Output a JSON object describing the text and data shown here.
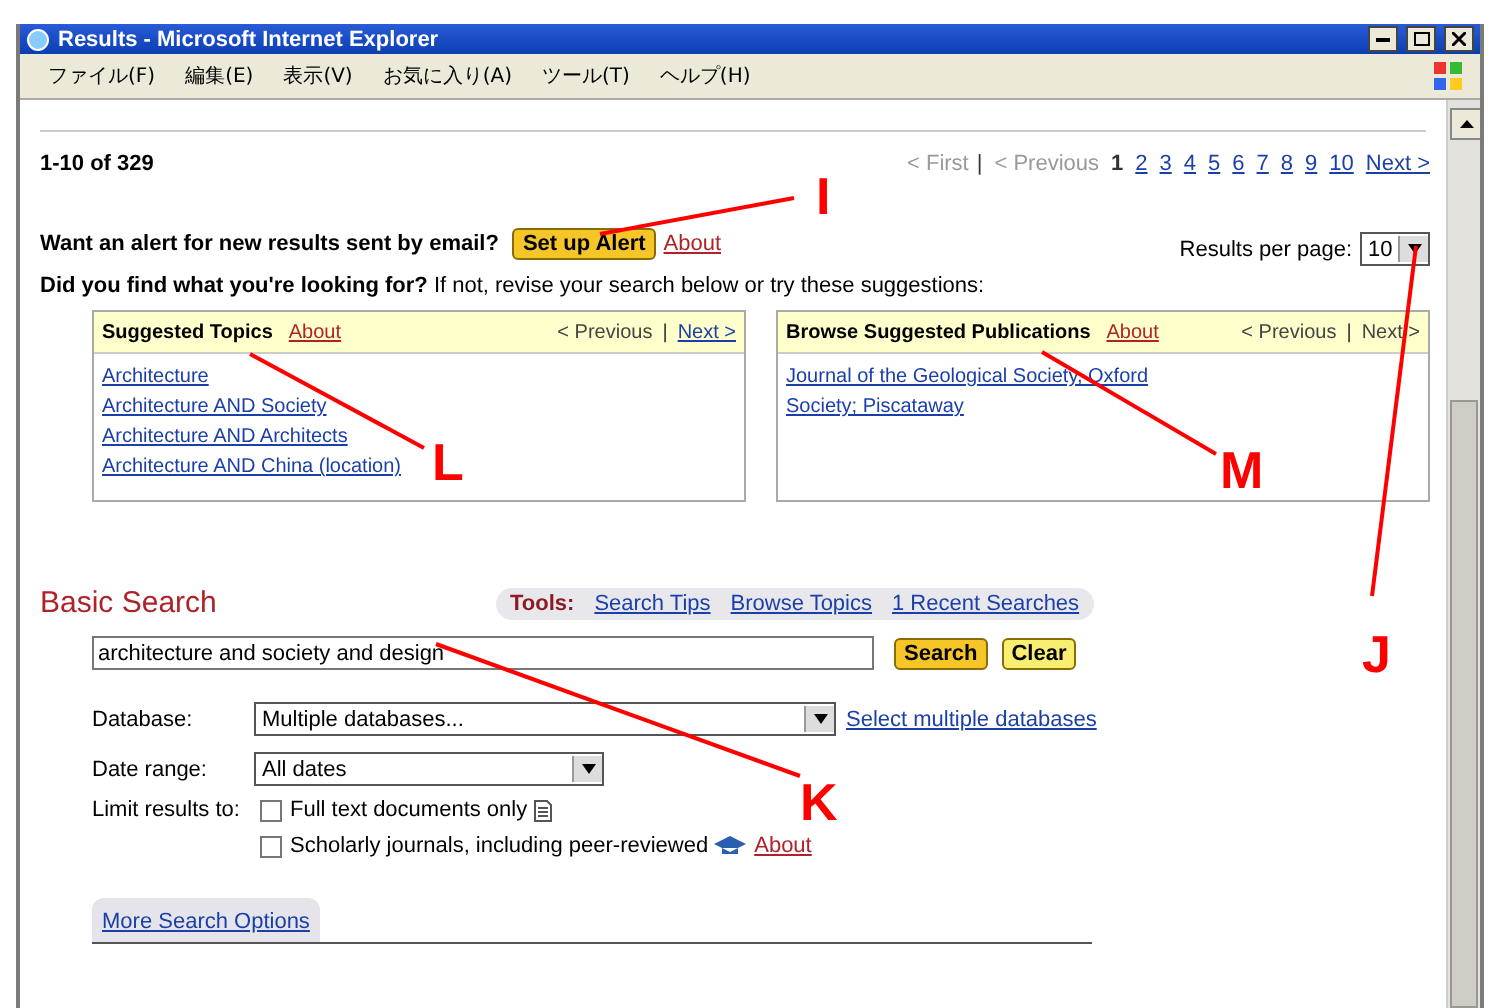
{
  "window": {
    "title": "Results - Microsoft Internet Explorer"
  },
  "menu": [
    "ファイル(F)",
    "編集(E)",
    "表示(V)",
    "お気に入り(A)",
    "ツール(T)",
    "ヘルプ(H)"
  ],
  "results": {
    "range": "1-10 of 329",
    "separator": "|",
    "pager": [
      {
        "label": "< First",
        "kind": "disabled"
      },
      {
        "label": "< Previous",
        "kind": "disabled"
      },
      {
        "label": "1",
        "kind": "current"
      },
      {
        "label": "2",
        "kind": "link"
      },
      {
        "label": "3",
        "kind": "link"
      },
      {
        "label": "4",
        "kind": "link"
      },
      {
        "label": "5",
        "kind": "link"
      },
      {
        "label": "6",
        "kind": "link"
      },
      {
        "label": "7",
        "kind": "link"
      },
      {
        "label": "8",
        "kind": "link"
      },
      {
        "label": "9",
        "kind": "link"
      },
      {
        "label": "10",
        "kind": "link"
      },
      {
        "label": "Next >",
        "kind": "link"
      }
    ]
  },
  "alert": {
    "text": "Want an alert for new results sent by email?",
    "button": "Set up Alert",
    "about": "About"
  },
  "per_page": {
    "label": "Results per page:",
    "value": "10"
  },
  "suggest_line": "**Did you find what you're looking for?** If not, revise your search below or try these suggestions:",
  "panels": [
    {
      "title": "Suggested Topics",
      "about": "About",
      "previous": "< Previous",
      "separator": "|",
      "next": "Next >",
      "next_link": true,
      "items": [
        "Architecture",
        "Architecture AND Society",
        "Architecture AND Architects",
        "Architecture AND China (location)"
      ]
    },
    {
      "title": "Browse Suggested Publications",
      "about": "About",
      "previous": "< Previous",
      "separator": "|",
      "next": "Next >",
      "next_link": false,
      "items": [
        "Journal of the Geological Society, Oxford",
        "Society; Piscataway"
      ]
    }
  ],
  "basic_search": {
    "title": "Basic Search",
    "tools_label": "Tools:",
    "tools": [
      "Search Tips",
      "Browse Topics",
      "1 Recent Searches"
    ],
    "query": "architecture and society and design",
    "search_button": "Search",
    "clear_button": "Clear",
    "database_label": "Database:",
    "database": "Multiple databases...",
    "database_link": "Select multiple databases",
    "date_label": "Date range:",
    "date": "All dates",
    "limit_label": "Limit results to:",
    "limits": [
      {
        "label": "Full text documents only",
        "checked": false,
        "kind": "fulltext"
      },
      {
        "label": "Scholarly journals, including peer-reviewed",
        "checked": false,
        "kind": "scholarly",
        "about": "About"
      }
    ],
    "more_options": "More Search Options"
  },
  "annotations": [
    {
      "label": "I"
    },
    {
      "label": "L"
    },
    {
      "label": "M"
    },
    {
      "label": "J"
    },
    {
      "label": "K"
    }
  ]
}
